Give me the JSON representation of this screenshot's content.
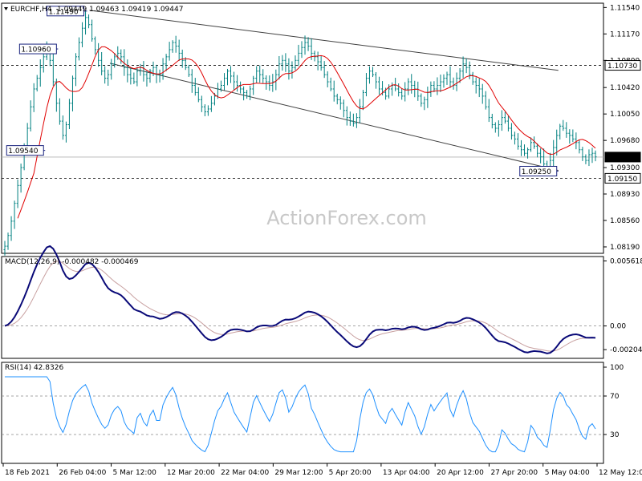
{
  "chart_data": {
    "type": "candlestick",
    "instrument": "EURCHF,H4",
    "ohlc_text": "1.09449 1.09463 1.09419 1.09447",
    "watermark": "ActionForex.com",
    "x_tick_labels": [
      "18 Feb 2021",
      "26 Feb 04:00",
      "5 Mar 12:00",
      "12 Mar 20:00",
      "22 Mar 04:00",
      "29 Mar 12:00",
      "5 Apr 20:00",
      "13 Apr 04:00",
      "20 Apr 12:00",
      "27 Apr 20:00",
      "5 May 04:00",
      "12 May 12:00"
    ],
    "main": {
      "ylim": [
        1.081,
        1.116
      ],
      "y_ticks": [
        "1.11540",
        "1.11170",
        "1.10800",
        "1.10420",
        "1.10050",
        "1.09680",
        "1.09300",
        "1.08930",
        "1.08560",
        "1.08190"
      ],
      "price_labels": [
        "1.10730",
        "1.09447",
        "1.09150"
      ],
      "horizontal_levels": [
        1.1073,
        1.0915
      ],
      "callouts": [
        "1.11490",
        "1.10960",
        "1.09540",
        "1.09250"
      ],
      "channel_upper": [
        [
          0.146,
          1.115
        ],
        [
          0.925,
          1.1066
        ]
      ],
      "channel_lower": [
        [
          0.18,
          1.1076
        ],
        [
          0.925,
          1.0926
        ]
      ],
      "closes": [
        1.082,
        1.0835,
        1.0855,
        1.088,
        1.0905,
        1.093,
        1.0955,
        1.0985,
        1.1015,
        1.104,
        1.1055,
        1.107,
        1.1085,
        1.1095,
        1.108,
        1.105,
        1.102,
        1.0995,
        1.0975,
        1.099,
        1.102,
        1.1055,
        1.1085,
        1.1105,
        1.1125,
        1.114,
        1.113,
        1.111,
        1.1095,
        1.108,
        1.1065,
        1.1055,
        1.106,
        1.1075,
        1.1085,
        1.109,
        1.1085,
        1.107,
        1.106,
        1.1055,
        1.105,
        1.1065,
        1.107,
        1.106,
        1.1055,
        1.1065,
        1.107,
        1.106,
        1.106,
        1.1075,
        1.1085,
        1.1095,
        1.1105,
        1.11,
        1.109,
        1.108,
        1.107,
        1.106,
        1.1045,
        1.1035,
        1.1025,
        1.1015,
        1.1008,
        1.1012,
        1.102,
        1.103,
        1.104,
        1.1045,
        1.1055,
        1.1065,
        1.1058,
        1.105,
        1.1045,
        1.104,
        1.1035,
        1.103,
        1.104,
        1.1055,
        1.1065,
        1.106,
        1.1055,
        1.105,
        1.1045,
        1.105,
        1.106,
        1.1075,
        1.108,
        1.1075,
        1.1065,
        1.107,
        1.108,
        1.109,
        1.1098,
        1.1105,
        1.11,
        1.109,
        1.1085,
        1.1078,
        1.107,
        1.106,
        1.105,
        1.104,
        1.103,
        1.1025,
        1.102,
        1.101,
        1.1,
        1.0995,
        1.0992,
        1.1,
        1.1015,
        1.1035,
        1.1055,
        1.1065,
        1.106,
        1.105,
        1.104,
        1.1035,
        1.103,
        1.104,
        1.1045,
        1.104,
        1.1035,
        1.103,
        1.104,
        1.105,
        1.1045,
        1.104,
        1.103,
        1.102,
        1.1025,
        1.1035,
        1.1045,
        1.104,
        1.1045,
        1.105,
        1.1055,
        1.106,
        1.105,
        1.1045,
        1.1055,
        1.1065,
        1.1075,
        1.107,
        1.106,
        1.105,
        1.1045,
        1.104,
        1.103,
        1.1015,
        1.1,
        1.099,
        1.0985,
        1.099,
        1.1,
        1.0995,
        1.0985,
        1.0975,
        1.097,
        1.096,
        1.0955,
        1.095,
        1.0955,
        1.0965,
        1.096,
        1.095,
        1.0945,
        1.0935,
        1.093,
        1.094,
        1.0958,
        1.0975,
        1.0988,
        1.0985,
        1.0978,
        1.0975,
        1.097,
        1.0965,
        1.0955,
        1.0945,
        1.094,
        1.0948,
        1.095,
        1.0945
      ]
    },
    "macd": {
      "label": "MACD(12,26,9) -0.000482 -0.000469",
      "ylim": [
        -0.0028,
        0.006
      ],
      "y_ticks": [
        "0.005618",
        "0.00",
        "-0.002046"
      ]
    },
    "rsi": {
      "label": "RSI(14) 42.8326",
      "ylim": [
        0,
        105
      ],
      "levels": [
        70,
        30
      ],
      "y_ticks": [
        "100",
        "70",
        "30"
      ]
    },
    "colors": {
      "candle": "#008080",
      "ma": "#e00000",
      "macd": "#0a0a78",
      "signal": "#c8a0a0",
      "rsi": "#1e90ff",
      "channel": "#404040",
      "label_box": "#1a237e"
    }
  }
}
